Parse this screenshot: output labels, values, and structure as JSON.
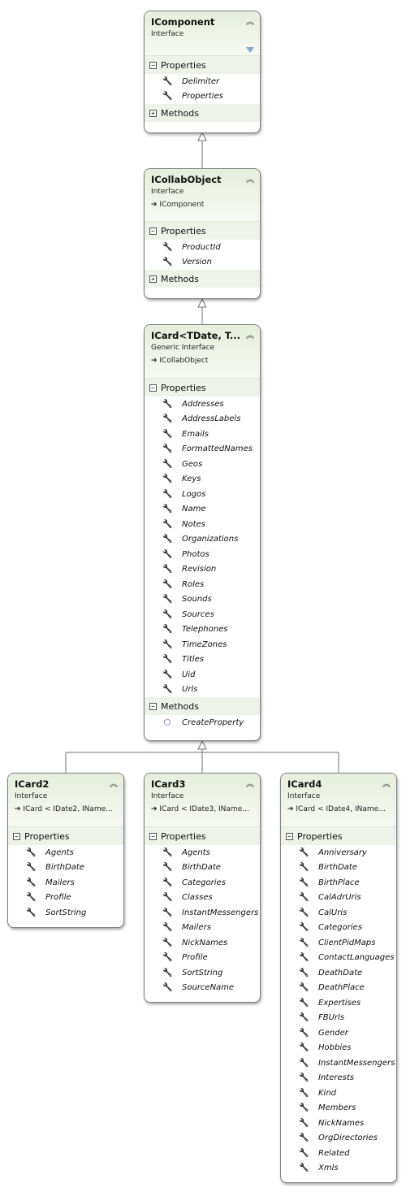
{
  "boxes": [
    {
      "title": "IComponent",
      "kind": "Interface",
      "parent": "",
      "filter": true,
      "sections": [
        {
          "label": "Properties",
          "expanded": true,
          "items": [
            "Delimiter",
            "Properties"
          ],
          "icon": "wrench-icon"
        },
        {
          "label": "Methods",
          "expanded": false,
          "items": []
        }
      ]
    },
    {
      "title": "ICollabObject",
      "kind": "Interface",
      "parent": "IComponent",
      "sections": [
        {
          "label": "Properties",
          "expanded": true,
          "items": [
            "ProductId",
            "Version"
          ],
          "icon": "wrench-icon"
        },
        {
          "label": "Methods",
          "expanded": false,
          "items": []
        }
      ]
    },
    {
      "title": "ICard<TDate, T...",
      "kind": "Generic Interface",
      "parent": "ICollabObject",
      "sections": [
        {
          "label": "Properties",
          "expanded": true,
          "icon": "wrench-icon",
          "items": [
            "Addresses",
            "AddressLabels",
            "Emails",
            "FormattedNames",
            "Geos",
            "Keys",
            "Logos",
            "Name",
            "Notes",
            "Organizations",
            "Photos",
            "Revision",
            "Roles",
            "Sounds",
            "Sources",
            "Telephones",
            "TimeZones",
            "Titles",
            "Uid",
            "Urls"
          ]
        },
        {
          "label": "Methods",
          "expanded": true,
          "icon": "method-cube-icon",
          "items": [
            "CreateProperty"
          ]
        }
      ]
    },
    {
      "title": "ICard2",
      "kind": "Interface",
      "parent": "ICard < IDate2, IName...",
      "sections": [
        {
          "label": "Properties",
          "expanded": true,
          "icon": "wrench-icon",
          "items": [
            "Agents",
            "BirthDate",
            "Mailers",
            "Profile",
            "SortString"
          ]
        }
      ]
    },
    {
      "title": "ICard3",
      "kind": "Interface",
      "parent": "ICard < IDate3, IName...",
      "sections": [
        {
          "label": "Properties",
          "expanded": true,
          "icon": "wrench-icon",
          "items": [
            "Agents",
            "BirthDate",
            "Categories",
            "Classes",
            "InstantMessengers",
            "Mailers",
            "NickNames",
            "Profile",
            "SortString",
            "SourceName"
          ]
        }
      ]
    },
    {
      "title": "ICard4",
      "kind": "Interface",
      "parent": "ICard < IDate4, IName...",
      "sections": [
        {
          "label": "Properties",
          "expanded": true,
          "icon": "wrench-icon",
          "items": [
            "Anniversary",
            "BirthDate",
            "BirthPlace",
            "CalAdrUris",
            "CalUris",
            "Categories",
            "ClientPidMaps",
            "ContactLanguages",
            "DeathDate",
            "DeathPlace",
            "Expertises",
            "FBUrls",
            "Gender",
            "Hobbies",
            "InstantMessengers",
            "Interests",
            "Kind",
            "Members",
            "NickNames",
            "OrgDirectories",
            "Related",
            "Xmls"
          ]
        }
      ]
    }
  ],
  "colors": {
    "header": "#e6eedc",
    "section": "#eef3ea",
    "method_icon": "#7a3fb0",
    "border": "#808080"
  }
}
